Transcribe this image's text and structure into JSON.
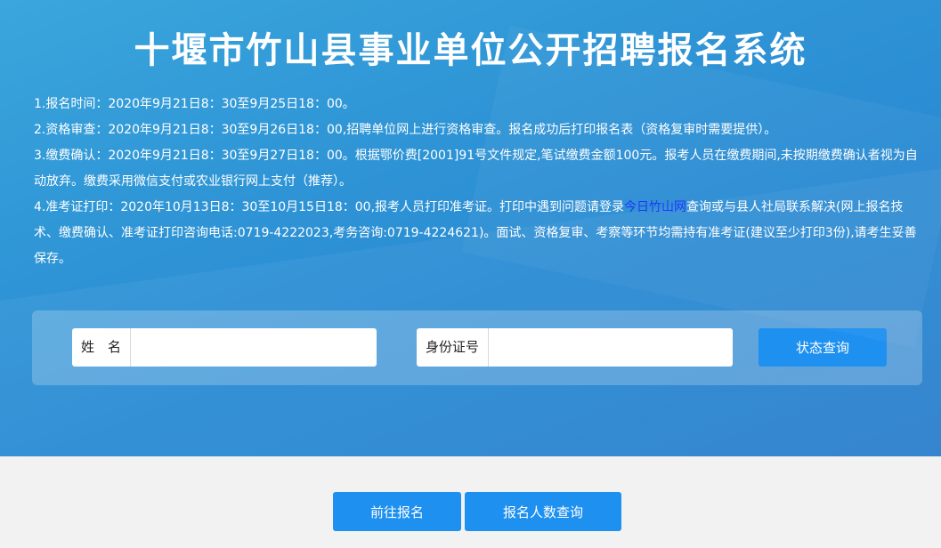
{
  "header": {
    "title": "十堰市竹山县事业单位公开招聘报名系统"
  },
  "notice": {
    "line1": "1.报名时间：2020年9月21日8：30至9月25日18：00。",
    "line2": "2.资格审查：2020年9月21日8：30至9月26日18：00,招聘单位网上进行资格审查。报名成功后打印报名表（资格复审时需要提供）。",
    "line3": "3.缴费确认：2020年9月21日8：30至9月27日18：00。根据鄂价费[2001]91号文件规定,笔试缴费金额100元。报考人员在缴费期间,未按期缴费确认者视为自动放弃。缴费采用微信支付或农业银行网上支付（推荐）。",
    "line4_pre": "4.准考证打印：2020年10月13日8：30至10月15日18：00,报考人员打印准考证。打印中遇到问题请登录",
    "line4_link": "今日竹山网",
    "line4_post": "查询或与县人社局联系解决(网上报名技术、缴费确认、准考证打印咨询电话:0719-4222023,考务咨询:0719-4224621)。面试、资格复审、考察等环节均需持有准考证(建议至少打印3份),请考生妥善保存。"
  },
  "search": {
    "name_label": "姓　名",
    "name_value": "",
    "id_label": "身份证号",
    "id_value": "",
    "status_button": "状态查询"
  },
  "footer": {
    "apply_button": "前往报名",
    "count_button": "报名人数查询"
  }
}
